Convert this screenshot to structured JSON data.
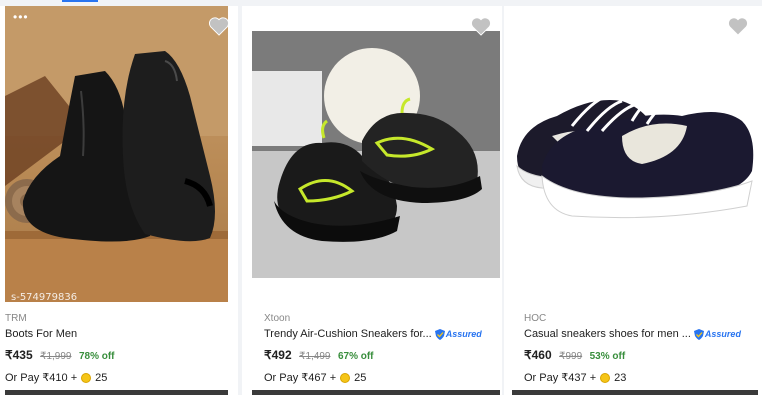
{
  "products": [
    {
      "brand": "TRM",
      "title": "Boots For Men",
      "price": "₹435",
      "mrp": "₹1,999",
      "discount": "78% off",
      "pay_text": "Or Pay ₹410 +",
      "coins": "25",
      "assured": false,
      "watermark": "s-574979836"
    },
    {
      "brand": "Xtoon",
      "title": "Trendy Air-Cushion Sneakers for...",
      "price": "₹492",
      "mrp": "₹1,499",
      "discount": "67% off",
      "pay_text": "Or Pay ₹467 +",
      "coins": "25",
      "assured": true,
      "assured_label": "Assured"
    },
    {
      "brand": "HOC",
      "title": "Casual sneakers shoes for men ...",
      "price": "₹460",
      "mrp": "₹999",
      "discount": "53% off",
      "pay_text": "Or Pay ₹437 +",
      "coins": "23",
      "assured": true,
      "assured_label": "Assured"
    }
  ],
  "colors": {
    "accent": "#2874f0",
    "discount": "#388e3c",
    "muted": "#878787",
    "coin": "#f5c518"
  },
  "icons": [
    "heart-icon",
    "assured-shield-icon",
    "supercoin-icon"
  ]
}
